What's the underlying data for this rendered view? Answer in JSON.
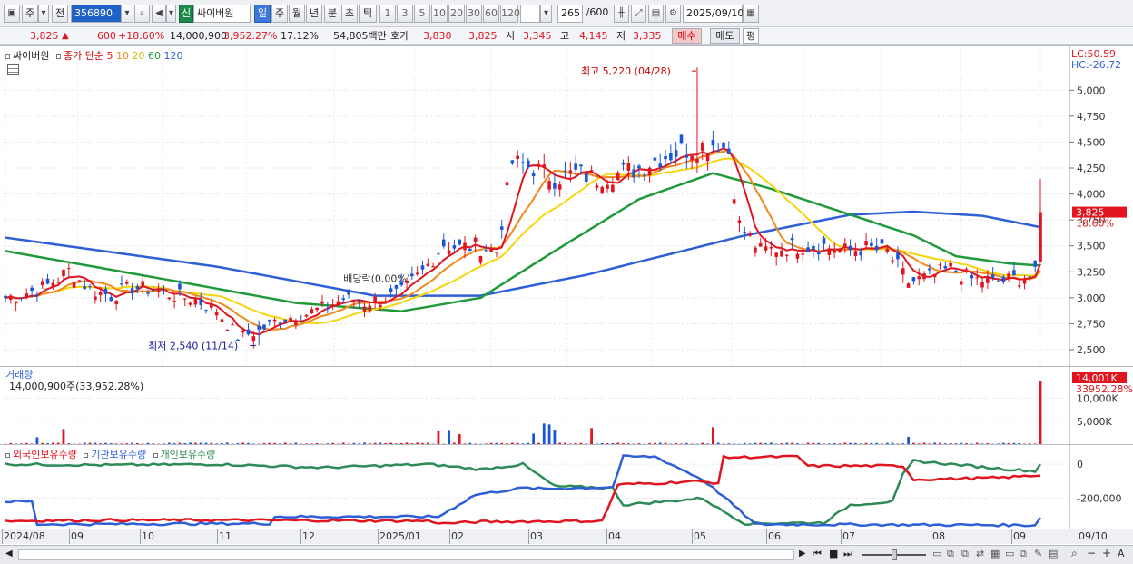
{
  "toolbar": {
    "period_main": "주",
    "prev_label": "전",
    "code": "356890",
    "new_badge": "신",
    "stock_name": "싸이버원",
    "periods": [
      "일",
      "주",
      "월",
      "년",
      "분",
      "초",
      "틱"
    ],
    "active_period": "일",
    "intervals": [
      "1",
      "3",
      "5",
      "10",
      "20",
      "30",
      "60",
      "120"
    ],
    "count": "265",
    "count_total": "/600",
    "date": "2025/09/10"
  },
  "quote": {
    "price": "3,825",
    "arrow": "▲",
    "change": "600",
    "change_pct": "+18.60%",
    "volume": "14,000,900",
    "volume_pct": "3,952.27%",
    "turnover": "17.12%",
    "amount": "54,805백만",
    "ask_label": "호가",
    "ask": "3,830",
    "bid": "3,825",
    "open_label": "시",
    "open": "3,345",
    "high_label": "고",
    "high": "4,145",
    "low_label": "저",
    "low": "3,335",
    "buy_label": "매수",
    "sell_label": "매도",
    "eval_label": "평"
  },
  "price_panel": {
    "legend_name": "싸이버원",
    "ma_title": "종가 단순",
    "ma_periods": [
      "5",
      "10",
      "20",
      "60",
      "120"
    ],
    "ma_colors": [
      "#e0151f",
      "#f08a1c",
      "#f5d60d",
      "#1f9a3a",
      "#2e5fd6"
    ],
    "lc_label": "LC:50.59",
    "hc_label": "HC:-26.72",
    "high_annotation": "최고 5,220 (04/28)",
    "low_annotation": "최저 2,540 (11/14)",
    "dividend_annotation": "배당락(0.00%)",
    "last_price_tag": "3,825",
    "last_change_tag": "18.60%"
  },
  "volume_panel": {
    "title": "거래량",
    "summary": "14,000,900주(33,952.28%)",
    "last_tag": "14,001K",
    "last_pct": "33952.28%"
  },
  "holdings_panel": {
    "series_names": [
      "외국인보유수량",
      "기관보유수량",
      "개인보유수량"
    ],
    "series_colors": [
      "#e0151f",
      "#2e5fd6",
      "#2e8b57"
    ]
  },
  "x_axis": {
    "labels": [
      "2024/08",
      "09",
      "10",
      "11",
      "12",
      "2025/01",
      "02",
      "03",
      "04",
      "05",
      "06",
      "07",
      "08",
      "09"
    ],
    "right_label": "09/10"
  },
  "chart_data": [
    {
      "type": "candlestick",
      "title": "싸이버원",
      "yaxis_ticks": [
        "5,000",
        "4,750",
        "4,500",
        "4,250",
        "4,000",
        "3,750",
        "3,500",
        "3,250",
        "3,000",
        "2,750",
        "2,500"
      ],
      "ylim": [
        2360,
        5300
      ],
      "close_path": [
        [
          0,
          3000
        ],
        [
          4,
          3050
        ],
        [
          8,
          3120
        ],
        [
          12,
          3260
        ],
        [
          16,
          3080
        ],
        [
          20,
          3020
        ],
        [
          24,
          3100
        ],
        [
          28,
          3080
        ],
        [
          32,
          3020
        ],
        [
          36,
          2980
        ],
        [
          40,
          2880
        ],
        [
          44,
          2620
        ],
        [
          48,
          2680
        ],
        [
          52,
          2800
        ],
        [
          56,
          2830
        ],
        [
          60,
          2900
        ],
        [
          64,
          2990
        ],
        [
          68,
          2950
        ],
        [
          72,
          3000
        ],
        [
          75,
          3050
        ],
        [
          79,
          3250
        ],
        [
          83,
          3520
        ],
        [
          86,
          3480
        ],
        [
          89,
          3500
        ],
        [
          93,
          3450
        ],
        [
          96,
          4300
        ],
        [
          100,
          4250
        ],
        [
          104,
          4150
        ],
        [
          108,
          4200
        ],
        [
          112,
          4150
        ],
        [
          116,
          4200
        ],
        [
          120,
          4250
        ],
        [
          124,
          4350
        ],
        [
          128,
          4420
        ],
        [
          131,
          4450
        ],
        [
          135,
          4500
        ],
        [
          137,
          4400
        ],
        [
          139,
          3700
        ],
        [
          143,
          3450
        ],
        [
          147,
          3480
        ],
        [
          151,
          3500
        ],
        [
          155,
          3500
        ],
        [
          159,
          3450
        ],
        [
          163,
          3480
        ],
        [
          167,
          3440
        ],
        [
          171,
          3150
        ],
        [
          175,
          3200
        ],
        [
          179,
          3280
        ],
        [
          183,
          3180
        ],
        [
          187,
          3150
        ],
        [
          191,
          3180
        ],
        [
          195,
          3220
        ],
        [
          196,
          3825
        ]
      ],
      "ma5_last": 3230,
      "ma20_last": 3180,
      "ma60_last": 3310,
      "ma120_last": 3680,
      "last_close": 3825,
      "last_high": 4145,
      "last_low": 3335,
      "last_open": 3345,
      "period_high": 5220,
      "period_low": 2540
    },
    {
      "type": "bar",
      "title": "거래량",
      "yaxis_ticks": [
        "10,000K",
        "5,000K"
      ],
      "ylim": [
        0,
        14500
      ],
      "unit": "K",
      "spikes": [
        {
          "t": 6,
          "v": 1500
        },
        {
          "t": 11,
          "v": 3300
        },
        {
          "t": 82,
          "v": 2800
        },
        {
          "t": 84,
          "v": 2900
        },
        {
          "t": 86,
          "v": 2200
        },
        {
          "t": 100,
          "v": 2300
        },
        {
          "t": 102,
          "v": 4500
        },
        {
          "t": 103,
          "v": 4300
        },
        {
          "t": 104,
          "v": 3000
        },
        {
          "t": 111,
          "v": 3500
        },
        {
          "t": 134,
          "v": 3700
        },
        {
          "t": 171,
          "v": 1600
        },
        {
          "t": 196,
          "v": 13800
        }
      ]
    },
    {
      "type": "line",
      "title": "외국인보유수량",
      "yaxis_ticks": [
        "0",
        "-200,000"
      ],
      "ylim": [
        -380000,
        60000
      ],
      "series": [
        {
          "name": "외국인보유수량",
          "points": [
            [
              0,
              -335000
            ],
            [
              20,
              -330000
            ],
            [
              40,
              -330000
            ],
            [
              80,
              -335000
            ],
            [
              83,
              -350000
            ],
            [
              90,
              -340000
            ],
            [
              113,
              -335000
            ],
            [
              116,
              -120000
            ],
            [
              125,
              -110000
            ],
            [
              130,
              -100000
            ],
            [
              135,
              -110000
            ],
            [
              136,
              40000
            ],
            [
              150,
              45000
            ],
            [
              152,
              -10000
            ],
            [
              170,
              -10000
            ],
            [
              172,
              -90000
            ],
            [
              188,
              -80000
            ],
            [
              196,
              -65000
            ]
          ]
        },
        {
          "name": "기관보유수량",
          "points": [
            [
              0,
              -220000
            ],
            [
              5,
              -220000
            ],
            [
              6,
              -355000
            ],
            [
              50,
              -350000
            ],
            [
              51,
              -310000
            ],
            [
              82,
              -310000
            ],
            [
              89,
              -180000
            ],
            [
              97,
              -145000
            ],
            [
              98,
              -140000
            ],
            [
              102,
              -145000
            ],
            [
              115,
              -135000
            ],
            [
              117,
              45000
            ],
            [
              123,
              45000
            ],
            [
              132,
              -90000
            ],
            [
              136,
              -190000
            ],
            [
              142,
              -355000
            ],
            [
              195,
              -360000
            ],
            [
              196,
              -310000
            ]
          ]
        },
        {
          "name": "개인보유수량",
          "points": [
            [
              0,
              0
            ],
            [
              20,
              -5000
            ],
            [
              40,
              0
            ],
            [
              60,
              -20000
            ],
            [
              80,
              0
            ],
            [
              90,
              -30000
            ],
            [
              98,
              0
            ],
            [
              104,
              -130000
            ],
            [
              115,
              -140000
            ],
            [
              117,
              -240000
            ],
            [
              125,
              -220000
            ],
            [
              132,
              -200000
            ],
            [
              135,
              -260000
            ],
            [
              140,
              -350000
            ],
            [
              155,
              -345000
            ],
            [
              160,
              -240000
            ],
            [
              168,
              -220000
            ],
            [
              170,
              -60000
            ],
            [
              172,
              20000
            ],
            [
              190,
              -30000
            ],
            [
              195,
              -40000
            ],
            [
              196,
              0
            ]
          ]
        }
      ]
    }
  ]
}
